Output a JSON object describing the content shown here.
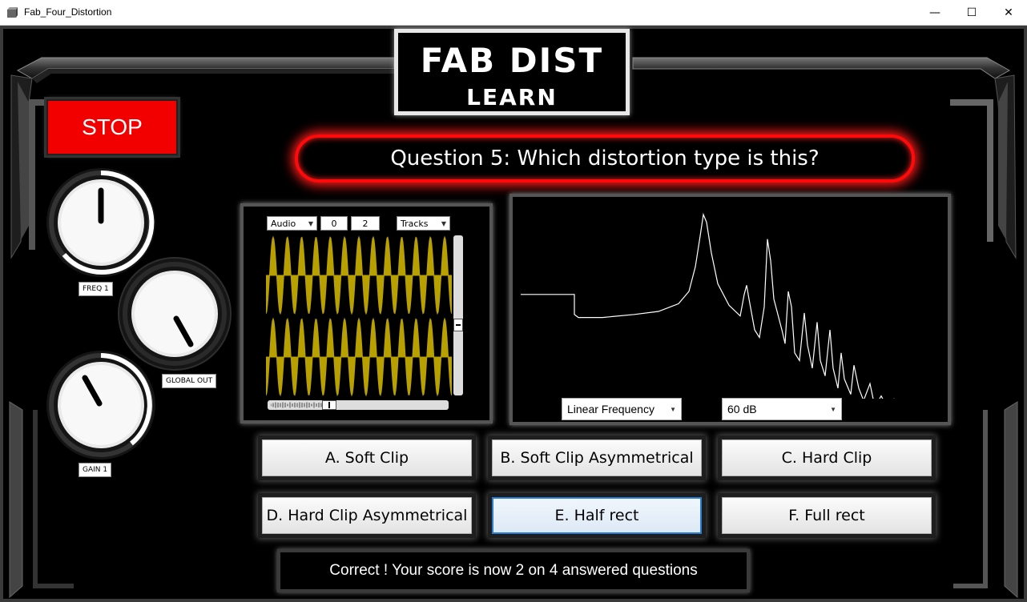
{
  "window": {
    "title": "Fab_Four_Distortion",
    "minimize": "—",
    "maximize": "☐",
    "close": "✕"
  },
  "header": {
    "line1": "FAB DIST",
    "line2": "LEARN"
  },
  "stop_button": "STOP",
  "question": "Question 5: Which distortion type is this?",
  "knobs": {
    "freq": {
      "label": "FREQ 1",
      "level": 0.5
    },
    "global_out": {
      "label": "GLOBAL OUT",
      "level": 0.85
    },
    "gain": {
      "label": "GAIN 1",
      "level": 0.3
    }
  },
  "scope": {
    "source": "Audio",
    "val1": "0",
    "val2": "2",
    "tracks": "Tracks",
    "wave_color": "#b8a000"
  },
  "spectrum": {
    "scale": "Linear Frequency",
    "range": "60 dB"
  },
  "answers": [
    {
      "id": "A",
      "label": "A.  Soft Clip"
    },
    {
      "id": "B",
      "label": "B.  Soft Clip Asymmetrical"
    },
    {
      "id": "C",
      "label": "C.  Hard Clip"
    },
    {
      "id": "D",
      "label": "D.  Hard Clip Asymmetrical"
    },
    {
      "id": "E",
      "label": "E.  Half rect"
    },
    {
      "id": "F",
      "label": "F.  Full rect"
    }
  ],
  "status": "Correct ! Your score is now 2 on 4 answered questions",
  "colors": {
    "stop": "#f20000",
    "question_glow": "#ff0a0a",
    "focus": "#2a7fd4"
  }
}
